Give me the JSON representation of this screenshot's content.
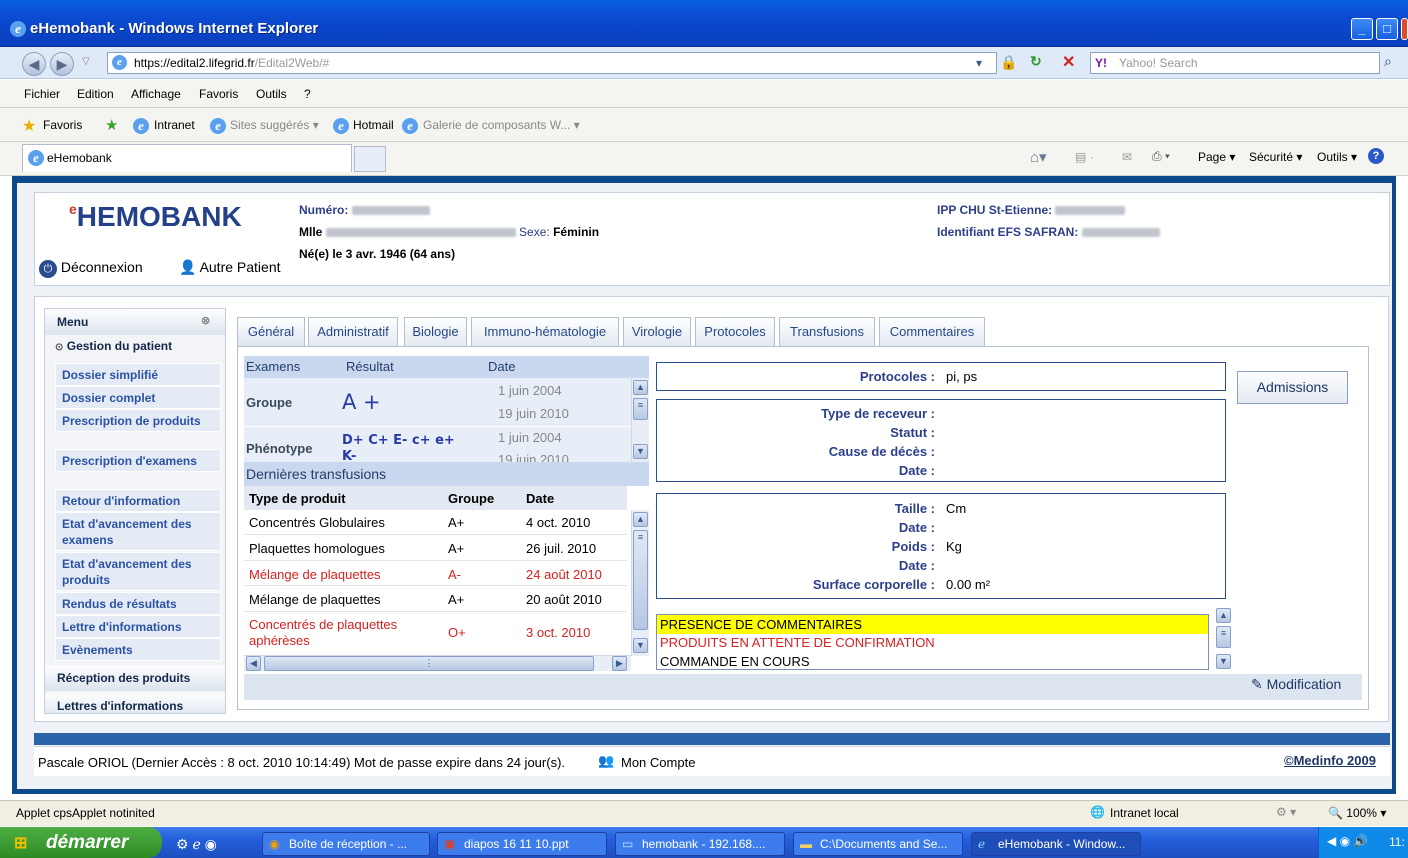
{
  "window": {
    "title": "eHemobank - Windows Internet Explorer"
  },
  "address": {
    "url_host": "https://edital2.lifegrid.fr",
    "url_path": "/Edital2Web/#",
    "search_placeholder": "Yahoo! Search"
  },
  "menubar": [
    "Fichier",
    "Edition",
    "Affichage",
    "Favoris",
    "Outils",
    "?"
  ],
  "favbar": {
    "favoris": "Favoris",
    "intranet": "Intranet",
    "sites": "Sites suggérés ▾",
    "hotmail": "Hotmail",
    "galerie": "Galerie de composants W... ▾"
  },
  "tabbar": {
    "tab": "eHemobank",
    "page": "Page ▾",
    "securite": "Sécurité ▾",
    "outils": "Outils ▾"
  },
  "header": {
    "logo": "HEMOBANK",
    "numero_label": "Numéro:",
    "mlle": "Mlle",
    "sexe_label": "Sexe:",
    "sexe": "Féminin",
    "naissance": "Né(e) le 3 avr. 1946 (64 ans)",
    "ipp_label": "IPP CHU St-Etienne:",
    "efs_label": "Identifiant EFS SAFRAN:",
    "deconnexion": "Déconnexion",
    "autre_patient": "Autre Patient"
  },
  "menu": {
    "title": "Menu",
    "gestion": "Gestion du patient",
    "items": [
      "Dossier simplifié",
      "Dossier complet",
      "Prescription de produits",
      "Prescription d'examens",
      "Retour d'information",
      "Etat d'avancement des examens",
      "Etat d'avancement des produits",
      "Rendus de résultats",
      "Lettre d'informations",
      "Evènements"
    ],
    "reception": "Réception des produits",
    "lettres": "Lettres d'informations"
  },
  "tabs": [
    "Général",
    "Administratif",
    "Biologie",
    "Immuno-hématologie",
    "Virologie",
    "Protocoles",
    "Transfusions",
    "Commentaires"
  ],
  "exams": {
    "cols": [
      "Examens",
      "Résultat",
      "Date"
    ],
    "groupe_label": "Groupe",
    "groupe_value": "A +",
    "groupe_dates": [
      "1 juin 2004",
      "19 juin 2010"
    ],
    "phenotype_label": "Phénotype",
    "phenotype_value": "D+ C+ E- c+ e+",
    "phenotype_value2": "K-",
    "phenotype_date": "1 juin 2004",
    "phenotype_date2": "19 juin 2010"
  },
  "transfusions": {
    "title": "Dernières transfusions",
    "cols": [
      "Type de produit",
      "Groupe",
      "Date"
    ],
    "rows": [
      {
        "type": "Concentrés Globulaires",
        "groupe": "A+",
        "date": "4 oct. 2010",
        "alert": false
      },
      {
        "type": "Plaquettes homologues",
        "groupe": "A+",
        "date": "26 juil. 2010",
        "alert": false
      },
      {
        "type": "Mélange de plaquettes",
        "groupe": "A-",
        "date": "24 août 2010",
        "alert": true
      },
      {
        "type": "Mélange de plaquettes",
        "groupe": "A+",
        "date": "20 août 2010",
        "alert": false
      },
      {
        "type": "Concentrés de plaquettes aphérèses",
        "groupe": "O+",
        "date": "3 oct. 2010",
        "alert": true
      }
    ]
  },
  "protocoles": {
    "label": "Protocoles :",
    "value": "pi, ps"
  },
  "receveur": {
    "type": "Type de receveur :",
    "statut": "Statut :",
    "cause": "Cause de décès :",
    "date": "Date :"
  },
  "mesures": {
    "taille": "Taille :",
    "taille_val": "Cm",
    "date1": "Date :",
    "poids": "Poids :",
    "poids_val": "Kg",
    "date2": "Date :",
    "surface": "Surface corporelle :",
    "surface_val": "0.00 m²"
  },
  "comments": [
    "PRESENCE DE COMMENTAIRES",
    "PRODUITS EN ATTENTE DE CONFIRMATION",
    "COMMANDE EN COURS"
  ],
  "buttons": {
    "admissions": "Admissions",
    "modification": "Modification"
  },
  "status": {
    "text": "Pascale ORIOL (Dernier Accès : 8 oct. 2010 10:14:49) Mot de passe expire dans 24 jour(s).",
    "mon_compte": "Mon Compte",
    "copyright": "©Medinfo 2009"
  },
  "ie_status": {
    "applet": "Applet cpsApplet notinited",
    "zone": "Intranet local",
    "zoom": "100%"
  },
  "taskbar": {
    "start": "démarrer",
    "tasks": [
      "Boîte de réception - ...",
      "diapos 16 11 10.ppt",
      "hemobank - 192.168....",
      "C:\\Documents and Se...",
      "eHemobank - Window..."
    ],
    "clock": "11:"
  }
}
